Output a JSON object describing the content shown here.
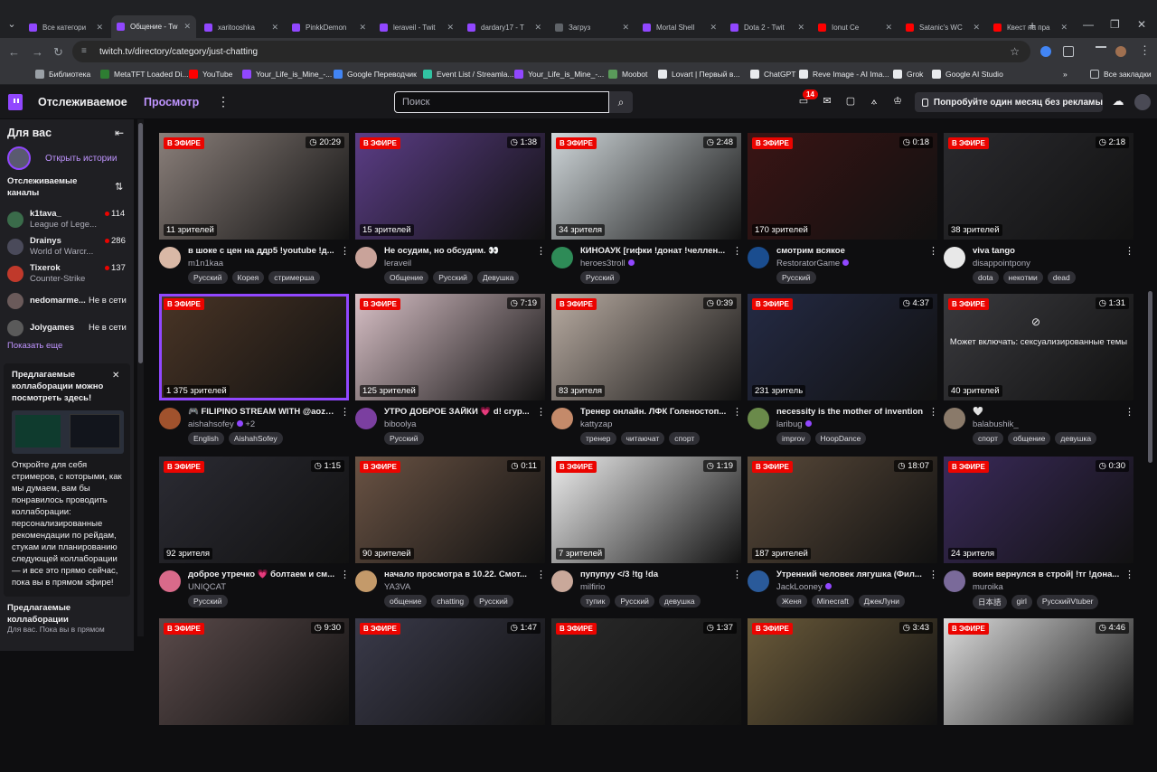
{
  "browser": {
    "tabs": [
      {
        "title": "Все категори",
        "color": "#9147ff"
      },
      {
        "title": "Общение - Tw",
        "color": "#9147ff",
        "active": true
      },
      {
        "title": "xaritooshka",
        "color": "#9147ff"
      },
      {
        "title": "PinkkDemon",
        "color": "#9147ff"
      },
      {
        "title": "leraveil - Twit",
        "color": "#9147ff"
      },
      {
        "title": "dardary17 - T",
        "color": "#9147ff"
      },
      {
        "title": "Загруз",
        "color": "#5f6368"
      },
      {
        "title": "Mortal Shell",
        "color": "#9147ff"
      },
      {
        "title": "Dota 2 - Twit",
        "color": "#9147ff"
      },
      {
        "title": "Ionut Ce",
        "color": "#ff0000"
      },
      {
        "title": "Satanic's WC",
        "color": "#ff0000"
      },
      {
        "title": "Квест на пра",
        "color": "#ff0000"
      }
    ],
    "url": "twitch.tv/directory/category/just-chatting",
    "bookmarks": [
      {
        "label": "Библиотека",
        "color": "#9aa0a6"
      },
      {
        "label": "MetaTFT Loaded Di...",
        "color": "#2e7d32"
      },
      {
        "label": "YouTube",
        "color": "#ff0000"
      },
      {
        "label": "Your_Life_is_Mine_-...",
        "color": "#9147ff"
      },
      {
        "label": "Google Переводчик",
        "color": "#4285f4"
      },
      {
        "label": "Event List / Streamla...",
        "color": "#31c3a2"
      },
      {
        "label": "Your_Life_is_Mine_-...",
        "color": "#9147ff"
      },
      {
        "label": "Moobot",
        "color": "#5a9a5a"
      },
      {
        "label": "Lovart | Первый в...",
        "color": "#e8eaed"
      },
      {
        "label": "ChatGPT",
        "color": "#e8eaed"
      },
      {
        "label": "Reve Image - AI Ima...",
        "color": "#e8eaed"
      },
      {
        "label": "Grok",
        "color": "#e8eaed"
      },
      {
        "label": "Google AI Studio",
        "color": "#e8eaed"
      }
    ],
    "all_bookmarks": "Все закладки"
  },
  "twitch_nav": {
    "following": "Отслеживаемое",
    "browse": "Просмотр",
    "search_placeholder": "Поиск",
    "notifications": "14",
    "prime": "Попробуйте один месяц без рекламы"
  },
  "sidebar": {
    "title": "Для вас",
    "history": "Открыть истории",
    "followed_title": "Отслеживаемые каналы",
    "channels": [
      {
        "name": "k1tava_",
        "game": "League of Lege...",
        "viewers": "114",
        "live": true,
        "color": "#3a6b4a"
      },
      {
        "name": "Drainys",
        "game": "World of Warcr...",
        "viewers": "286",
        "live": true,
        "color": "#4a4a5a"
      },
      {
        "name": "Tixerok",
        "game": "Counter-Strike",
        "viewers": "137",
        "live": true,
        "color": "#c0392b"
      },
      {
        "name": "nedomarme...",
        "offline": "Не в сети",
        "live": false,
        "color": "#6a5a5a"
      },
      {
        "name": "Jolygames",
        "offline": "Не в сети",
        "live": false,
        "color": "#5a5a5a"
      }
    ],
    "show_more": "Показать еще",
    "collab_title": "Предлагаемые коллаборации можно посмотреть здесь!",
    "collab_desc": "Откройте для себя стримеров, с которыми, как мы думаем, вам бы понравилось проводить коллаборации: персонализированные рекомендации по рейдам, стукам или планированию следующей коллаборации — и все это прямо сейчас, пока вы в прямом эфире!",
    "footer_title": "Предлагаемые коллаборации",
    "footer_desc": "Для вас. Пока вы в прямом"
  },
  "live_label": "В ЭФИРЕ",
  "streams": [
    {
      "title": "в шоке с цен на ддр5 !youtube !д...",
      "channel": "m1n1kaa",
      "viewers": "11 зрителей",
      "duration": "20:29",
      "tags": [
        "Русский",
        "Корея",
        "стримерша"
      ],
      "bg": "#8a7f7a",
      "avatar": "#d9b8a6"
    },
    {
      "title": "Не осудим, но обсудим. 👀",
      "channel": "leraveil",
      "viewers": "15 зрителей",
      "duration": "1:38",
      "tags": [
        "Общение",
        "Русский",
        "Девушка"
      ],
      "bg": "#5b3d86",
      "avatar": "#c9a39a"
    },
    {
      "title": "КИНОАУК [гифки !донат !челлен...",
      "channel": "heroes3troll",
      "verified": true,
      "viewers": "34 зрителя",
      "duration": "2:48",
      "tags": [
        "Русский"
      ],
      "bg": "#cfd6d9",
      "avatar": "#2e8b57"
    },
    {
      "title": "смотрим всякое",
      "channel": "RestoratorGame",
      "verified": true,
      "viewers": "170 зрителей",
      "duration": "0:18",
      "tags": [
        "Русский"
      ],
      "bg": "#3a1414",
      "avatar": "#1a4d8f"
    },
    {
      "title": "viva tango",
      "channel": "disappointpony",
      "viewers": "38 зрителей",
      "duration": "2:18",
      "tags": [
        "dota",
        "некотми",
        "dead"
      ],
      "bg": "#2a2a2e",
      "avatar": "#e8e8e8"
    },
    {
      "title": "🎮 FILIPINO STREAM WITH @aoza...",
      "channel": "aishahsofey",
      "extra": "+2",
      "verified": true,
      "viewers": "1 375 зрителей",
      "duration": "",
      "tags": [
        "English",
        "AishahSofey"
      ],
      "bg": "#4a3526",
      "avatar": "#a0522d",
      "selected": true
    },
    {
      "title": "УТРО ДОБРОЕ ЗАЙКИ 💗 d! сгур...",
      "channel": "biboolya",
      "viewers": "125 зрителей",
      "duration": "7:19",
      "tags": [
        "Русский"
      ],
      "bg": "#d8c0c6",
      "avatar": "#7b3fa0"
    },
    {
      "title": "Тренер онлайн. ЛФК Голеностоп...",
      "channel": "kattyzap",
      "viewers": "83 зрителя",
      "duration": "0:39",
      "tags": [
        "тренер",
        "читаючат",
        "спорт"
      ],
      "bg": "#b9aca2",
      "avatar": "#c48a6a"
    },
    {
      "title": "necessity is the mother of invention",
      "channel": "laribug",
      "verified": true,
      "viewers": "231 зритель",
      "duration": "4:37",
      "tags": [
        "improv",
        "HoopDance"
      ],
      "bg": "#242a44",
      "avatar": "#6a8a4a"
    },
    {
      "title": "🤍",
      "channel": "balabushik_",
      "viewers": "40 зрителей",
      "duration": "1:31",
      "tags": [
        "спорт",
        "общение",
        "девушка"
      ],
      "bg": "#3a3a3e",
      "avatar": "#8a7a6a",
      "warning": "Может включать: сексуализированные темы"
    },
    {
      "title": "доброе утречко 💗 болтаем и см...",
      "channel": "UNIQCAT",
      "viewers": "92 зрителя",
      "duration": "1:15",
      "tags": [
        "Русский"
      ],
      "bg": "#2b2b33",
      "avatar": "#d96a8a"
    },
    {
      "title": "начало просмотра в 10.22. Смот...",
      "channel": "YA3VA",
      "viewers": "90 зрителей",
      "duration": "0:11",
      "tags": [
        "общение",
        "chatting",
        "Русский"
      ],
      "bg": "#6a5344",
      "avatar": "#c49a6a"
    },
    {
      "title": "пупупуу </3 !tg !da",
      "channel": "milfirio",
      "viewers": "7 зрителей",
      "duration": "1:19",
      "tags": [
        "тупик",
        "Русский",
        "девушка"
      ],
      "bg": "#eeeeee",
      "avatar": "#c9a89a"
    },
    {
      "title": "Утренний человек лягушка (Фил...",
      "channel": "JackLooney",
      "verified": true,
      "viewers": "187 зрителей",
      "duration": "18:07",
      "tags": [
        "Женя",
        "Minecraft",
        "ДжекЛуни"
      ],
      "bg": "#5a4a3a",
      "avatar": "#2a5a9a"
    },
    {
      "title": "воин вернулся в строй| !тг !дона...",
      "channel": "muroika",
      "viewers": "24 зрителя",
      "duration": "0:30",
      "tags": [
        "日本語",
        "girl",
        "РусскийVtuber"
      ],
      "bg": "#3a2a5a",
      "avatar": "#7a6a9a"
    },
    {
      "title": "",
      "channel": "",
      "viewers": "",
      "duration": "9:30",
      "tags": [],
      "bg": "#5a4a4a",
      "avatar": "#555"
    },
    {
      "title": "",
      "channel": "",
      "viewers": "",
      "duration": "1:47",
      "tags": [],
      "bg": "#3a3a4a",
      "avatar": "#555"
    },
    {
      "title": "",
      "channel": "",
      "viewers": "",
      "duration": "1:37",
      "tags": [],
      "bg": "#2a2a2a",
      "avatar": "#555"
    },
    {
      "title": "",
      "channel": "",
      "viewers": "",
      "duration": "3:43",
      "tags": [],
      "bg": "#6a5a3a",
      "avatar": "#555"
    },
    {
      "title": "",
      "channel": "",
      "viewers": "",
      "duration": "4:46",
      "tags": [],
      "bg": "#dcdcdc",
      "avatar": "#555"
    }
  ]
}
